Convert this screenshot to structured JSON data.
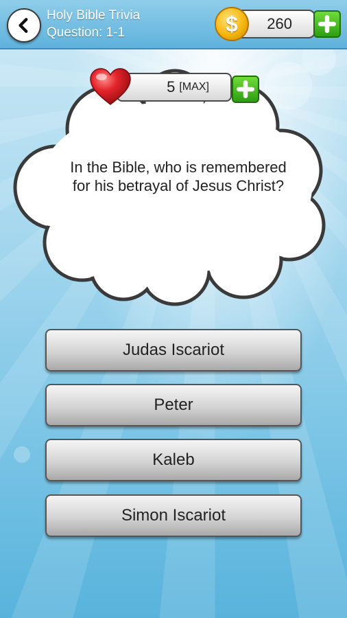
{
  "header": {
    "title": "Holy Bible Trivia",
    "subtitle": "Question: 1-1",
    "coins": "260"
  },
  "lives": {
    "count": "5",
    "max_label": "[MAX]"
  },
  "question": {
    "text": "In the Bible, who is remembered for his betrayal of Jesus Christ?"
  },
  "answers": [
    {
      "label": "Judas Iscariot"
    },
    {
      "label": "Peter"
    },
    {
      "label": "Kaleb"
    },
    {
      "label": "Simon Iscariot"
    }
  ],
  "icons": [
    "back-arrow-icon",
    "coin-icon",
    "plus-icon",
    "heart-icon"
  ],
  "colors": {
    "header": "#5fb2dc",
    "plus_button": "#2e9e12",
    "coin": "#f5b70e",
    "heart": "#d81f26"
  }
}
